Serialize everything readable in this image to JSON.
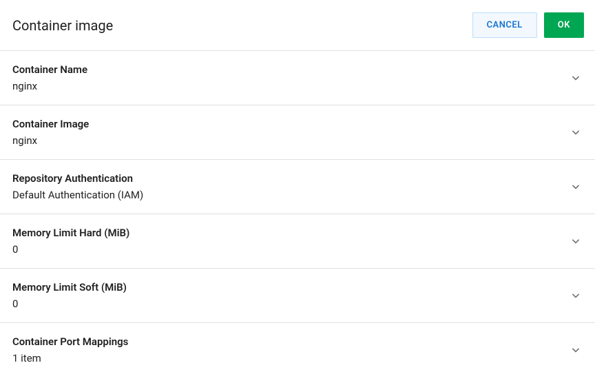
{
  "header": {
    "title": "Container image",
    "cancel_label": "CANCEL",
    "ok_label": "OK"
  },
  "rows": [
    {
      "label": "Container Name",
      "value": "nginx"
    },
    {
      "label": "Container Image",
      "value": "nginx"
    },
    {
      "label": "Repository Authentication",
      "value": "Default Authentication (IAM)"
    },
    {
      "label": "Memory Limit Hard (MiB)",
      "value": "0"
    },
    {
      "label": "Memory Limit Soft (MiB)",
      "value": "0"
    },
    {
      "label": "Container Port Mappings",
      "value": "1 item"
    }
  ]
}
